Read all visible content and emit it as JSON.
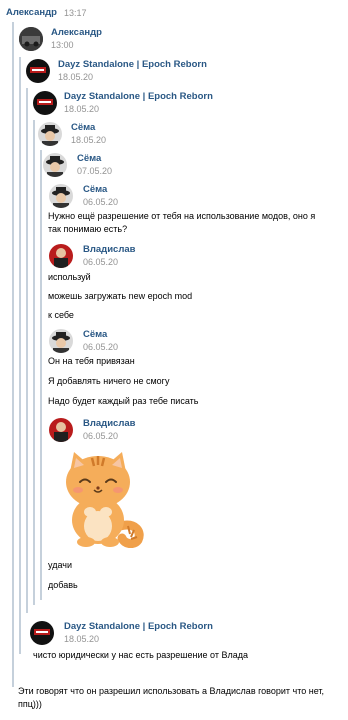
{
  "top": {
    "author": "Александр",
    "time": "13:17"
  },
  "messages": [
    {
      "author": "Александр",
      "time": "13:00"
    },
    {
      "author": "Dayz Standalone | Epoch Reborn",
      "time": "18.05.20"
    },
    {
      "author": "Dayz Standalone | Epoch Reborn",
      "time": "18.05.20"
    },
    {
      "author": "Сёма",
      "time": "18.05.20"
    },
    {
      "author": "Сёма",
      "time": "07.05.20"
    },
    {
      "author": "Сёма",
      "time": "06.05.20",
      "lines": [
        "Нужно ещё разрешение от тебя на использование модов, оно я",
        "так понимаю есть?"
      ]
    },
    {
      "author": "Владислав",
      "time": "06.05.20",
      "lines": [
        "используй",
        "можешь загружать new epoch mod",
        "к себе"
      ]
    },
    {
      "author": "Сёма",
      "time": "06.05.20",
      "lines": [
        "Он на тебя привязан",
        "Я добавлять ничего не смогу",
        "Надо будет каждый раз тебе писать"
      ]
    },
    {
      "author": "Владислав",
      "time": "06.05.20",
      "lines": [
        "удачи",
        "добавь"
      ]
    },
    {
      "author": "Dayz Standalone | Epoch Reborn",
      "time": "18.05.20",
      "lines": [
        "чисто юридически у нас есть разрешение от Влада"
      ]
    }
  ],
  "footer": {
    "text": "Эти говорят что он разрешил использовать а Владислав говорит что нет, ппц)))"
  },
  "colors": {
    "link": "#2a5885",
    "thread_bar": "#c5d0db",
    "time": "#939393"
  }
}
